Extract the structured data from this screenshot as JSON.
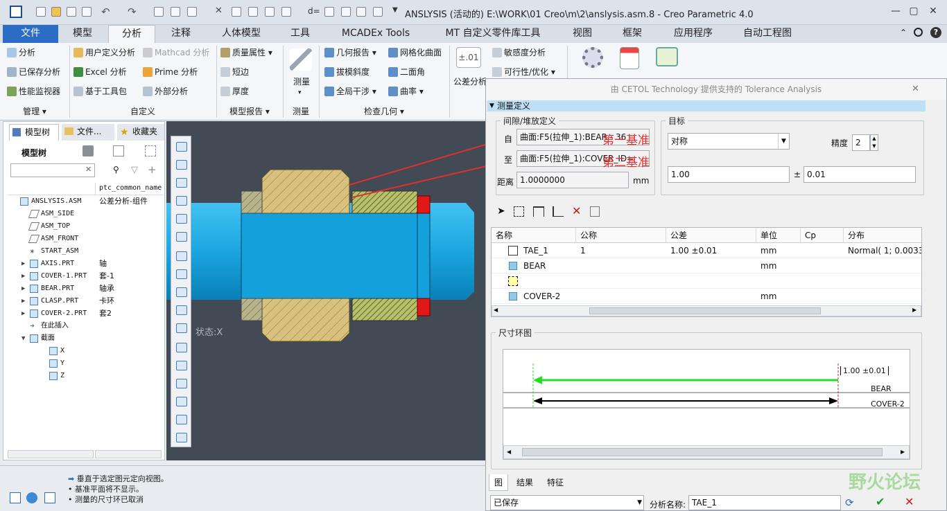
{
  "app": {
    "window_title": "ANSLYSIS (活动的) E:\\WORK\\01 Creo\\m\\2\\anslysis.asm.8 - Creo Parametric 4.0"
  },
  "ribbon_tabs": [
    {
      "label": "文件"
    },
    {
      "label": "模型"
    },
    {
      "label": "分析"
    },
    {
      "label": "注释"
    },
    {
      "label": "人体模型"
    },
    {
      "label": "工具"
    },
    {
      "label": "MCADEx Tools"
    },
    {
      "label": "MT 自定义零件库工具"
    },
    {
      "label": "视图"
    },
    {
      "label": "框架"
    },
    {
      "label": "应用程序"
    },
    {
      "label": "自动工程图"
    }
  ],
  "ribbon": {
    "manage": {
      "analysis": "分析",
      "saved_analysis": "已保存分析",
      "perf_monitor": "性能监视器",
      "group": "管理"
    },
    "custom": {
      "user_defined": "用户定义分析",
      "mathcad": "Mathcad 分析",
      "excel": "Excel 分析",
      "prime": "Prime 分析",
      "toolkit": "基于工具包",
      "external": "外部分析",
      "group": "自定义"
    },
    "model_report": {
      "mass_props": "质量属性",
      "short_edge": "短边",
      "thickness": "厚度",
      "group": "模型报告"
    },
    "measure": {
      "measure": "测量",
      "group": "测量"
    },
    "inspect": {
      "geom_report": "几何报告",
      "mesh_surface": "网格化曲面",
      "draft": "拔模斜度",
      "dihedral": "二面角",
      "interference": "全局干涉",
      "curvature": "曲率",
      "group": "检查几何"
    },
    "tolerance": {
      "tol_analysis": "公差分析",
      "tol_icon_text": "±.01",
      "sensitivity": "敏感度分析",
      "feasibility": "可行性/优化"
    }
  },
  "left_panel": {
    "tabs": [
      "模型树",
      "文件...",
      "收藏夹"
    ],
    "tree_label": "模型树",
    "col2_header": "ptc_common_name",
    "rows": [
      {
        "name": "ANSLYSIS.ASM",
        "value": "公差分析-组件",
        "indent": 0,
        "expand": "",
        "icon": "assembly-icon"
      },
      {
        "name": "ASM_SIDE",
        "value": "",
        "indent": 1,
        "expand": "",
        "icon": "datum-plane-icon"
      },
      {
        "name": "ASM_TOP",
        "value": "",
        "indent": 1,
        "expand": "",
        "icon": "datum-plane-icon"
      },
      {
        "name": "ASM_FRONT",
        "value": "",
        "indent": 1,
        "expand": "",
        "icon": "datum-plane-icon"
      },
      {
        "name": "START_ASM",
        "value": "",
        "indent": 1,
        "expand": "",
        "icon": "csys-icon"
      },
      {
        "name": "AXIS.PRT",
        "value": "轴",
        "indent": 1,
        "expand": "▶",
        "icon": "part-icon"
      },
      {
        "name": "COVER-1.PRT",
        "value": "套-1",
        "indent": 1,
        "expand": "▶",
        "icon": "part-icon"
      },
      {
        "name": "BEAR.PRT",
        "value": "轴承",
        "indent": 1,
        "expand": "▶",
        "icon": "part-icon"
      },
      {
        "name": "CLASP.PRT",
        "value": "卡环",
        "indent": 1,
        "expand": "▶",
        "icon": "part-icon"
      },
      {
        "name": "COVER-2.PRT",
        "value": "套2",
        "indent": 1,
        "expand": "▶",
        "icon": "part-icon"
      },
      {
        "name": "在此插入",
        "value": "",
        "indent": 1,
        "expand": "",
        "icon": "insert-here-icon"
      },
      {
        "name": "截面",
        "value": "",
        "indent": 1,
        "expand": "▼",
        "icon": "section-icon"
      },
      {
        "name": "X",
        "value": "",
        "indent": 3,
        "expand": "",
        "icon": "section-plane-icon"
      },
      {
        "name": "Y",
        "value": "",
        "indent": 3,
        "expand": "",
        "icon": "section-plane-icon"
      },
      {
        "name": "Z",
        "value": "",
        "indent": 3,
        "expand": "",
        "icon": "section-plane-icon"
      }
    ]
  },
  "viewport": {
    "state_label": "状态:X"
  },
  "status_messages": [
    "垂直于选定图元定向视图。",
    "基准平面将不显示。",
    "测量的尺寸环已取消"
  ],
  "dialog": {
    "title": "由 CETOL Technology 提供支持的 Tolerance Analysis",
    "section": "测量定义",
    "gap_group": "间隙/堆放定义",
    "from_label": "自",
    "from_value": "曲面:F5(拉伸_1):BEAR - 36",
    "to_label": "至",
    "to_value": "曲面:F5(拉伸_1):COVER_ID=",
    "annotation_1": "第一基准",
    "annotation_2": "第二基准",
    "distance_label": "距离",
    "distance_value": "1.0000000",
    "distance_unit": "mm",
    "target_group": "目标",
    "target_type": "对称",
    "precision_label": "精度",
    "precision_value": "2",
    "nominal_value": "1.00",
    "pm": "±",
    "tolerance_value": "0.01",
    "grid": {
      "headers": [
        "名称",
        "公称",
        "公差",
        "单位",
        "Cp",
        "分布"
      ],
      "rows": [
        {
          "name": "TAE_1",
          "nominal": "1",
          "tolerance": "1.00 ±0.01",
          "unit": "mm",
          "cp": "",
          "dist": "Normal( 1; 0.0033",
          "icon": "dimension-icon"
        },
        {
          "name": "BEAR",
          "nominal": "",
          "tolerance": "",
          "unit": "mm",
          "cp": "",
          "dist": "",
          "icon": "part-icon"
        },
        {
          "name": "",
          "nominal": "",
          "tolerance": "",
          "unit": "",
          "cp": "",
          "dist": "",
          "icon": "empty-slot-icon"
        },
        {
          "name": "COVER-2",
          "nominal": "",
          "tolerance": "",
          "unit": "mm",
          "cp": "",
          "dist": "",
          "icon": "part-icon"
        }
      ]
    },
    "loop_group": "尺寸环图",
    "loop_tag": "1.00 ±0.01",
    "loop_label_1": "BEAR",
    "loop_label_2": "COVER-2",
    "bottom_tabs": [
      "图",
      "结果",
      "特征"
    ],
    "save_state": "已保存",
    "analysis_name_label": "分析名称:",
    "analysis_name": "TAE_1"
  },
  "watermark": "野火论坛",
  "colors": {
    "accent": "#2b6cc4",
    "section_bg": "#bde0f7",
    "shaft": "#1ba6e0",
    "bearing": "#d8c07e",
    "loop_arrow": "#22dd22",
    "annotation": "#e03030"
  }
}
